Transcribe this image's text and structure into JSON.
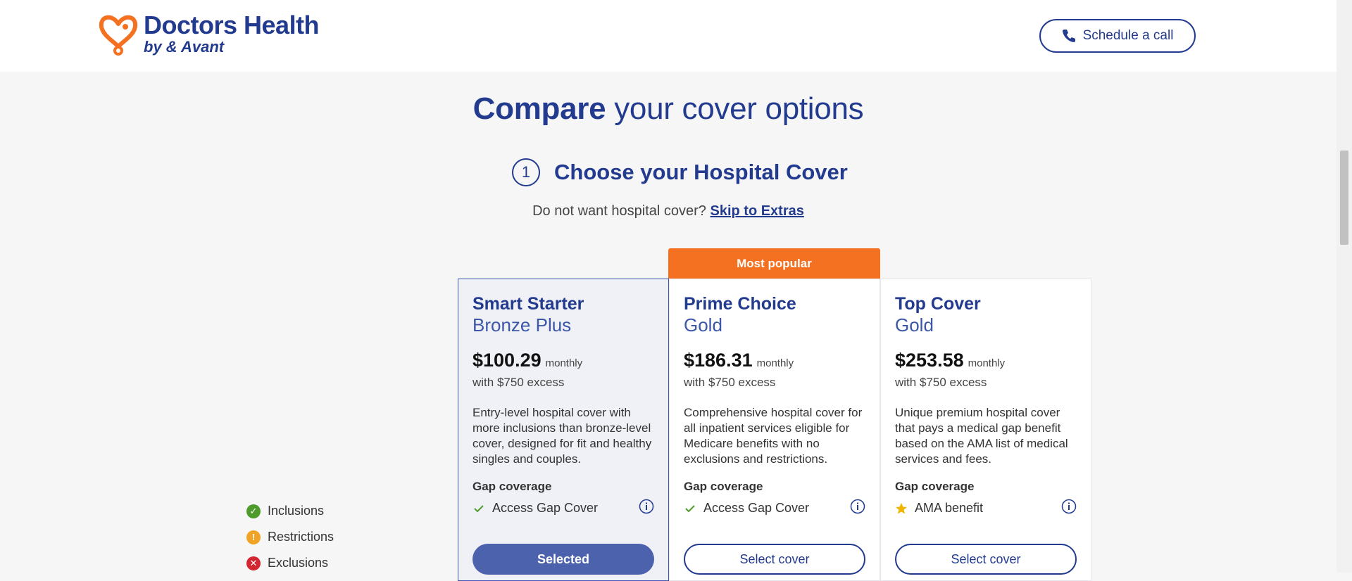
{
  "header": {
    "logo_title": "Doctors Health",
    "logo_sub": "by & Avant",
    "call_label": "Schedule a call"
  },
  "page": {
    "title_bold": "Compare",
    "title_rest": " your cover options",
    "step_number": "1",
    "step_title": "Choose your Hospital Cover",
    "skip_prompt": "Do not want hospital cover? ",
    "skip_link": "Skip to Extras"
  },
  "legend": [
    {
      "label": "Inclusions",
      "icon": "check-circle-icon",
      "color": "#4d9b2a"
    },
    {
      "label": "Restrictions",
      "icon": "exclamation-circle-icon",
      "color": "#f0a325"
    },
    {
      "label": "Exclusions",
      "icon": "x-circle-icon",
      "color": "#d22630"
    }
  ],
  "ribbon": "Most popular",
  "cards": [
    {
      "name": "Smart Starter",
      "tier": "Bronze Plus",
      "price": "$100.29",
      "period": "monthly",
      "excess": "with $750 excess",
      "description": "Entry-level hospital cover with more inclusions than bronze-level cover, designed for fit and healthy singles and couples.",
      "gap_title": "Gap coverage",
      "gap_item": "Access Gap Cover",
      "gap_icon": "check-icon",
      "cta": "Selected",
      "selected": true
    },
    {
      "name": "Prime Choice",
      "tier": "Gold",
      "price": "$186.31",
      "period": "monthly",
      "excess": "with $750 excess",
      "description": "Comprehensive hospital cover for all inpatient services eligible for Medicare benefits with no exclusions and restrictions.",
      "gap_title": "Gap coverage",
      "gap_item": "Access Gap Cover",
      "gap_icon": "check-icon",
      "cta": "Select cover",
      "selected": false
    },
    {
      "name": "Top Cover",
      "tier": "Gold",
      "price": "$253.58",
      "period": "monthly",
      "excess": "with $750 excess",
      "description": "Unique premium hospital cover that pays a medical gap benefit based on the AMA list of medical services and fees.",
      "gap_title": "Gap coverage",
      "gap_item": "AMA benefit",
      "gap_icon": "star-icon",
      "cta": "Select cover",
      "selected": false
    }
  ],
  "colors": {
    "brand": "#233b8f",
    "accent": "#f37121",
    "selected_button": "#4c62ad"
  }
}
